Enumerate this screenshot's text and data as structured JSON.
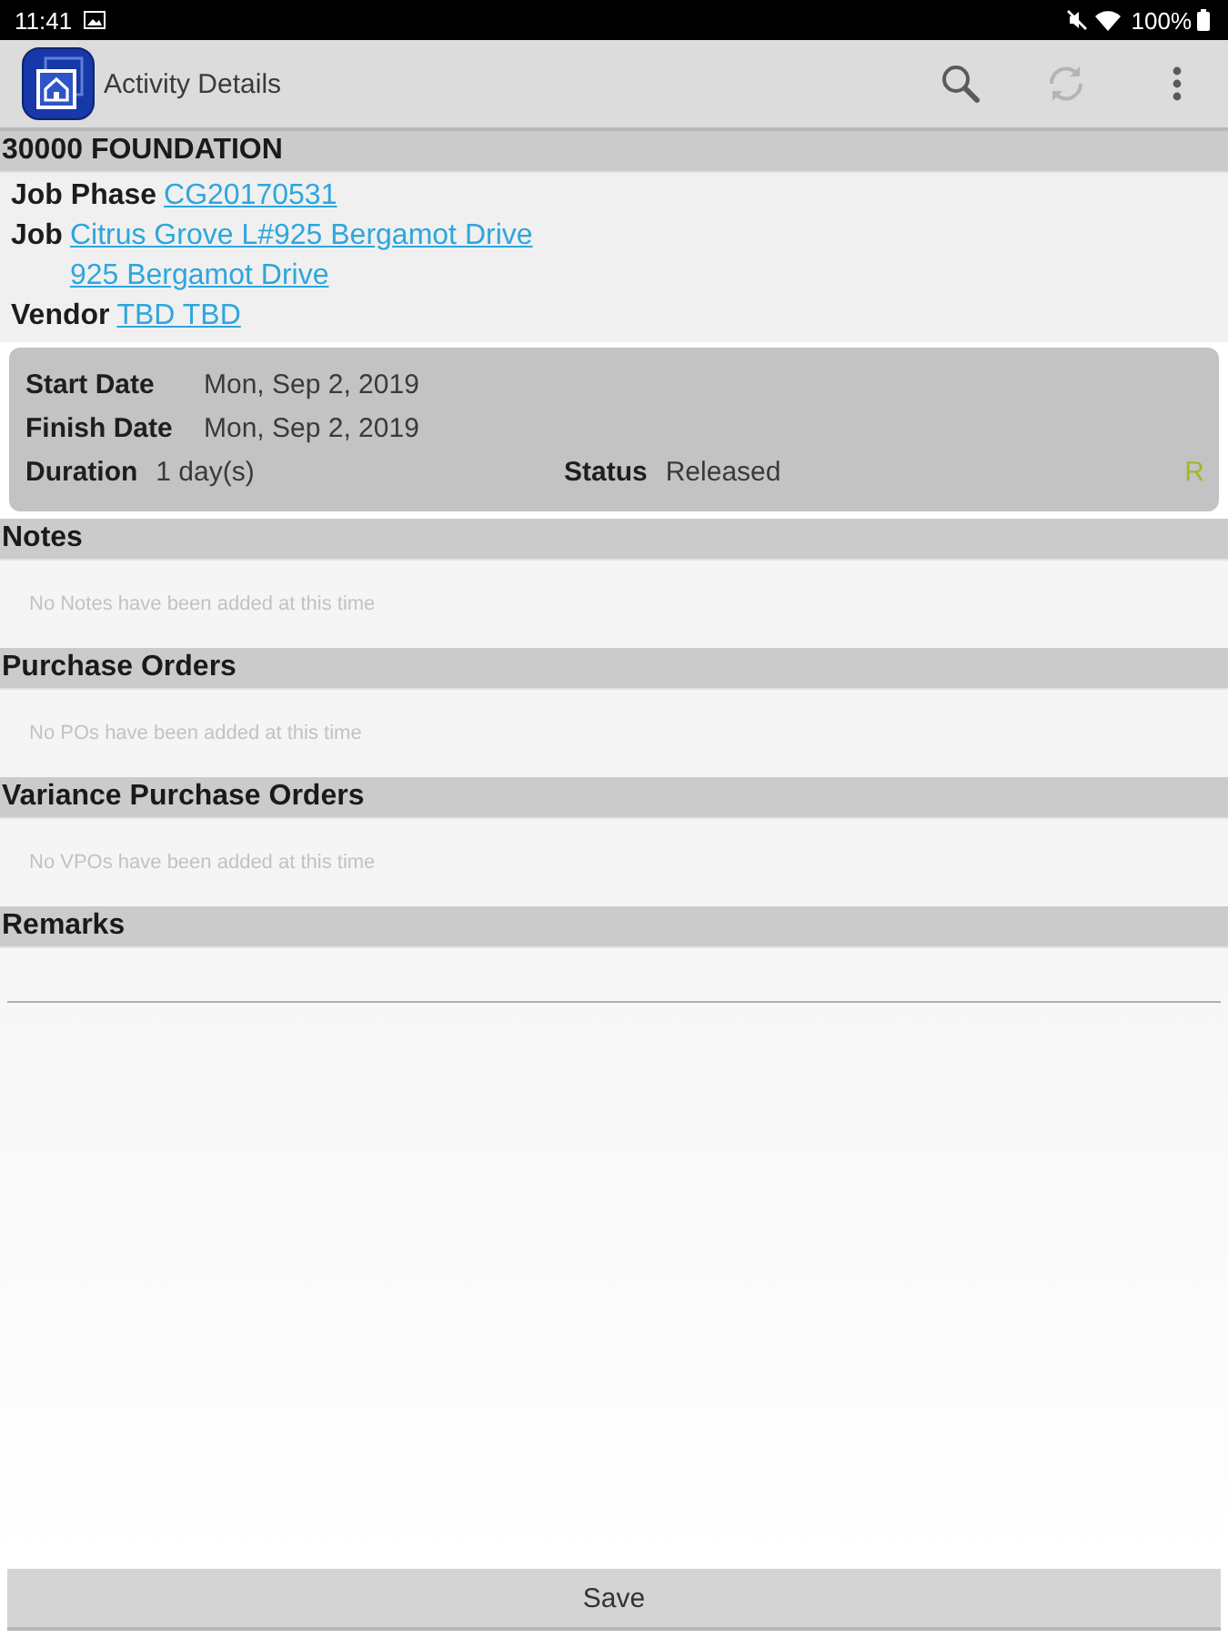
{
  "status_bar": {
    "time": "11:41",
    "battery": "100%"
  },
  "app_bar": {
    "title": "Activity Details",
    "actions": [
      {
        "kind": "search",
        "disabled": false
      },
      {
        "kind": "sync",
        "disabled": true
      },
      {
        "kind": "menu",
        "disabled": false
      }
    ]
  },
  "activity": {
    "title": "30000 FOUNDATION",
    "fields": [
      {
        "label": "Job Phase",
        "values": [
          "CG20170531"
        ]
      },
      {
        "label": "Job",
        "values": [
          "Citrus Grove L#925 Bergamot Drive",
          "925 Bergamot Drive"
        ]
      },
      {
        "label": "Vendor",
        "values": [
          "TBD TBD"
        ]
      }
    ]
  },
  "schedule": {
    "rows": [
      {
        "label": "Start Date",
        "value": "Mon, Sep 2, 2019"
      },
      {
        "label": "Finish Date",
        "value": "Mon, Sep 2, 2019"
      }
    ],
    "duration": {
      "label": "Duration",
      "value": "1 day(s)"
    },
    "status": {
      "label": "Status",
      "value": "Released",
      "code": "R"
    }
  },
  "sections": [
    {
      "title": "Notes",
      "empty_text": "No Notes have been added at this time"
    },
    {
      "title": "Purchase Orders",
      "empty_text": "No POs have been added at this time"
    },
    {
      "title": "Variance Purchase Orders",
      "empty_text": "No VPOs have been added at this time"
    }
  ],
  "remarks": {
    "title": "Remarks"
  },
  "save_button": {
    "label": "Save"
  }
}
